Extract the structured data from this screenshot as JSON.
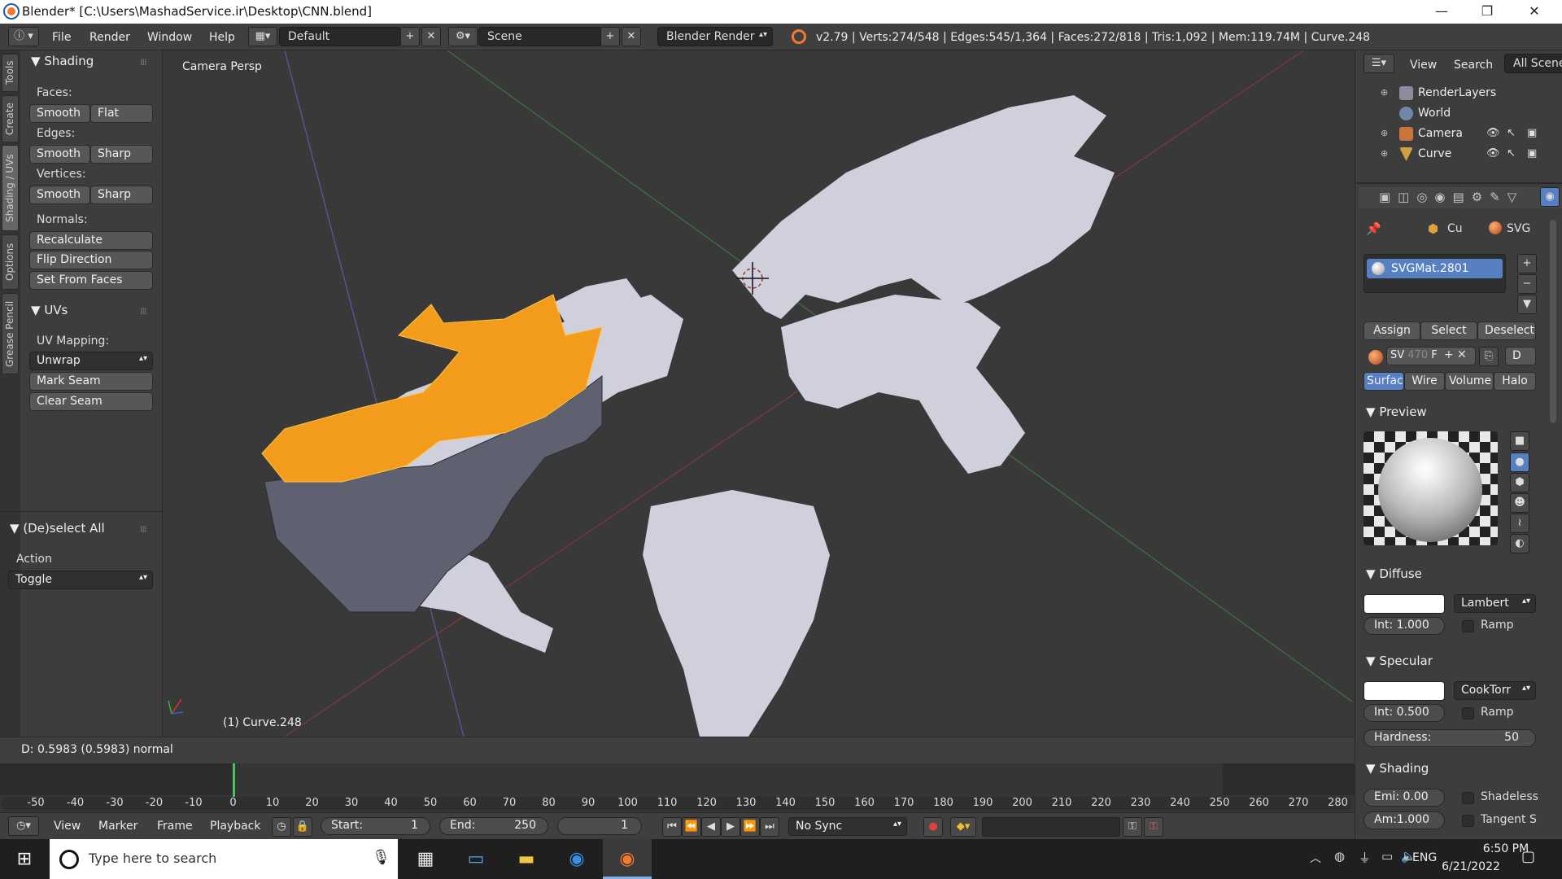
{
  "titlebar": {
    "title": "Blender* [C:\\Users\\MashadService.ir\\Desktop\\CNN.blend]",
    "minimize": "—",
    "restore": "❐",
    "close": "✕"
  },
  "menubar": {
    "items": [
      "File",
      "Render",
      "Window",
      "Help"
    ],
    "layout": "Default",
    "scene": "Scene",
    "engine": "Blender Render",
    "stats": "v2.79 | Verts:274/548 | Edges:545/1,364 | Faces:272/818 | Tris:1,092 | Mem:119.74M | Curve.248"
  },
  "tabs": [
    "Tools",
    "Create",
    "Shading / UVs",
    "Options",
    "Grease Pencil"
  ],
  "toolshelf": {
    "shading": {
      "title": "Shading",
      "faces_label": "Faces:",
      "faces_smooth": "Smooth",
      "faces_flat": "Flat",
      "edges_label": "Edges:",
      "edges_smooth": "Smooth",
      "edges_sharp": "Sharp",
      "vertices_label": "Vertices:",
      "verts_smooth": "Smooth",
      "verts_sharp": "Sharp",
      "normals_label": "Normals:",
      "recalculate": "Recalculate",
      "flip": "Flip Direction",
      "set_from_faces": "Set From Faces"
    },
    "uvs": {
      "title": "UVs",
      "mapping_label": "UV Mapping:",
      "unwrap": "Unwrap",
      "mark_seam": "Mark Seam",
      "clear_seam": "Clear Seam"
    },
    "operator": {
      "title": "(De)select All",
      "action_label": "Action",
      "action_value": "Toggle"
    }
  },
  "viewport": {
    "view_label": "Camera Persp",
    "object_label": "(1) Curve.248"
  },
  "infobar": {
    "text": "D: 0.5983 (0.5983) normal"
  },
  "timeline": {
    "ticks": [
      "-50",
      "-40",
      "-30",
      "-20",
      "-10",
      "0",
      "10",
      "20",
      "30",
      "40",
      "50",
      "60",
      "70",
      "80",
      "90",
      "100",
      "110",
      "120",
      "130",
      "140",
      "150",
      "160",
      "170",
      "180",
      "190",
      "200",
      "210",
      "220",
      "230",
      "240",
      "250",
      "260",
      "270",
      "280"
    ],
    "current_frame": "0",
    "menus": [
      "View",
      "Marker",
      "Frame",
      "Playback"
    ],
    "start_label": "Start:",
    "start": "1",
    "end_label": "End:",
    "end": "250",
    "frame": "1",
    "sync": "No Sync"
  },
  "outliner": {
    "view": "View",
    "search": "Search",
    "scenes": "All Scenes",
    "items": [
      "RenderLayers",
      "World",
      "Camera",
      "Curve"
    ]
  },
  "properties": {
    "breadcrumb_object": "Cu",
    "breadcrumb_material": "SVG",
    "material_name": "SVGMat.2801",
    "assign": "Assign",
    "select": "Select",
    "deselect": "Deselect",
    "mat_short": "SV",
    "users": "470",
    "fake": "F",
    "data": "D",
    "tabs": [
      "Surface",
      "Wire",
      "Volume",
      "Halo"
    ],
    "preview_title": "Preview",
    "diffuse": {
      "title": "Diffuse",
      "shader": "Lambert",
      "intensity": "Int: 1.000",
      "ramp": "Ramp"
    },
    "specular": {
      "title": "Specular",
      "shader": "CookTorr",
      "intensity": "Int: 0.500",
      "ramp": "Ramp",
      "hardness_label": "Hardness:",
      "hardness": "50"
    },
    "shading": {
      "title": "Shading",
      "emit": "Emi: 0.00",
      "shadeless": "Shadeless",
      "ambient": "Am:1.000",
      "tangent": "Tangent S"
    }
  },
  "taskbar": {
    "search_placeholder": "Type here to search",
    "language": "ENG",
    "time": "6:50 PM",
    "date": "6/21/2022"
  },
  "colors": {
    "accent_blue": "#5680c2",
    "selection_orange": "#f39c1b",
    "map_fill": "#cfd0dc"
  }
}
